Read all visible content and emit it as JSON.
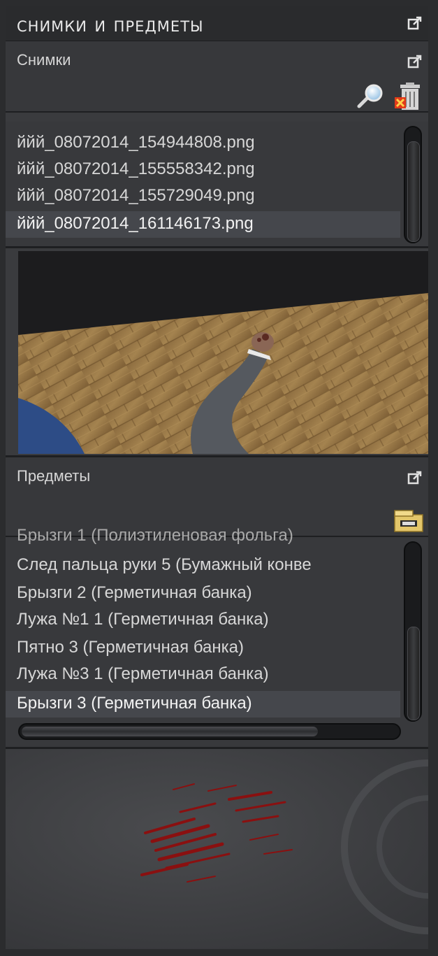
{
  "window": {
    "title": "Снимки и предметы"
  },
  "snapshots": {
    "label": "Снимки",
    "files": [
      "ййй_08072014_154944808.png",
      "ййй_08072014_155558342.png",
      "ййй_08072014_155729049.png",
      "ййй_08072014_161146173.png"
    ],
    "selected_index": 3,
    "scroll_position": 0.0
  },
  "items": {
    "label": "Предметы",
    "partial_top_row": "Брызги 1 (Полиэтиленовая фольга)",
    "list": [
      "След пальца руки 5 (Бумажный конве",
      "Брызги 2 (Герметичная банка)",
      "Лужа №1 1 (Герметичная банка)",
      "Пятно 3 (Герметичная банка)",
      "Лужа №3 1 (Герметичная банка)",
      "Брызги 3 (Герметичная банка)"
    ],
    "selected_index": 5,
    "vertical_scroll_position": 0.55,
    "horizontal_scroll_fraction": 0.78
  },
  "icons": {
    "popout": "popout-icon",
    "search": "magnifier-icon",
    "delete": "trash-icon",
    "evidence": "evidence-box-icon"
  },
  "colors": {
    "accent_blood": "#8a1010",
    "selection": "#45474c"
  }
}
